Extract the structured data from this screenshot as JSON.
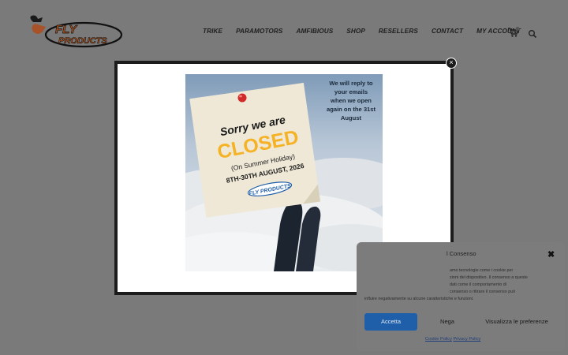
{
  "header": {
    "logo_text": "FLY PRODUCTS",
    "nav": [
      "TRIKE",
      "PARAMOTORS",
      "AMFIBIOUS",
      "SHOP",
      "RESELLERS",
      "CONTACT",
      "MY ACCOUNT"
    ],
    "cart_count": "0"
  },
  "modal": {
    "close_label": "×",
    "poster": {
      "note_line1": "Sorry we are",
      "note_closed": "CLOSED",
      "note_holiday": "(On Summer Holiday)",
      "note_dates": "8TH-30TH AUGUST, 2026",
      "note_logo": "FLY PRODUCTS",
      "reply_line1": "We will reply to",
      "reply_line2": "your emails",
      "reply_line3": "when we open",
      "reply_line4": "again on the 31st",
      "reply_line5": "August"
    }
  },
  "cookie": {
    "title": "l Consenso",
    "close_label": "✖",
    "text_line1": "amo tecnologie come i cookie per",
    "text_line2": "zioni del dispositivo. Il consenso a queste",
    "text_line3": "dati come il comportamento di",
    "text_line4": "consenso o ritirare il consenso può",
    "text_line5": "influire negativamente su alcune caratteristiche e funzioni.",
    "accept_label": "Accetta",
    "deny_label": "Nega",
    "prefs_label": "Visualizza le preferenze",
    "cookie_policy": "Cookie Policy",
    "privacy_policy": "Privacy Policy"
  },
  "colors": {
    "overlay_bg": "#7a7a7a",
    "accent_blue": "#1f5ea8",
    "closed_orange": "#f5b225"
  }
}
